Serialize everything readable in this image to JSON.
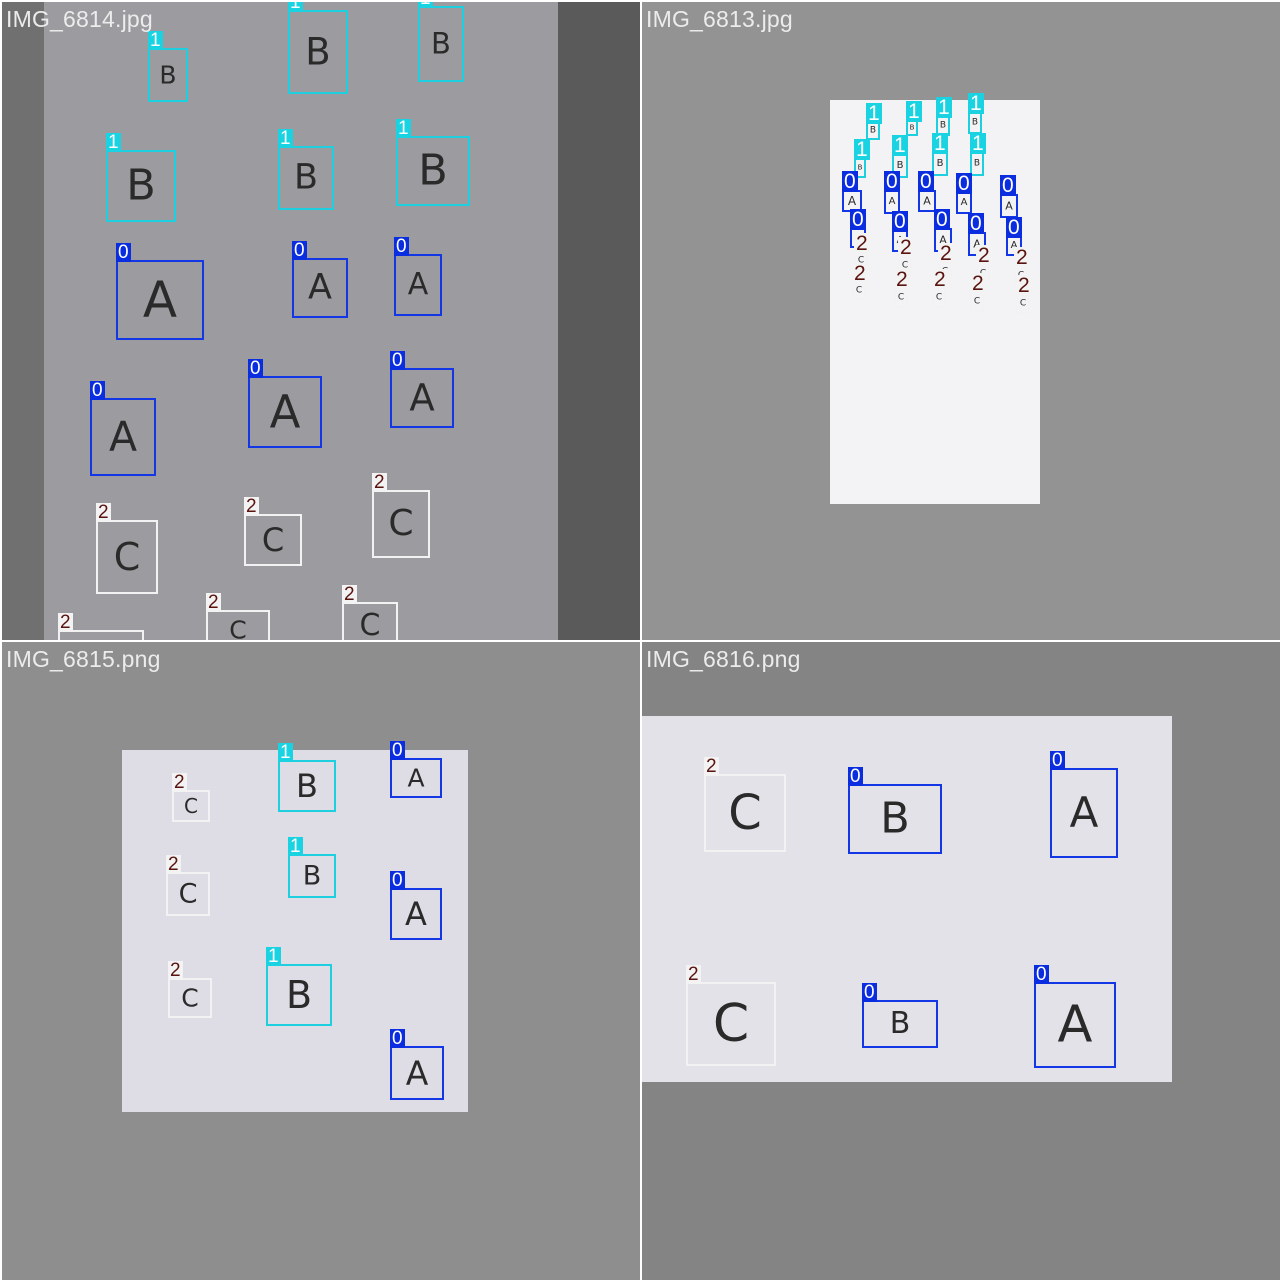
{
  "mosaic": {
    "tiles": [
      {
        "filename": "IMG_6814.jpg",
        "background": "#5a5a5a",
        "paper_color": "#9c9ca0",
        "detections": [
          {
            "cls": "1",
            "letter": "B"
          },
          {
            "cls": "1",
            "letter": "B"
          },
          {
            "cls": "1",
            "letter": "B"
          },
          {
            "cls": "1",
            "letter": "B"
          },
          {
            "cls": "1",
            "letter": "B"
          },
          {
            "cls": "1",
            "letter": "B"
          },
          {
            "cls": "0",
            "letter": "A"
          },
          {
            "cls": "0",
            "letter": "A"
          },
          {
            "cls": "0",
            "letter": "A"
          },
          {
            "cls": "0",
            "letter": "A"
          },
          {
            "cls": "0",
            "letter": "A"
          },
          {
            "cls": "0",
            "letter": "A"
          },
          {
            "cls": "2",
            "letter": "C"
          },
          {
            "cls": "2",
            "letter": "C"
          },
          {
            "cls": "2",
            "letter": "C"
          },
          {
            "cls": "2",
            "letter": ""
          },
          {
            "cls": "2",
            "letter": "C"
          },
          {
            "cls": "2",
            "letter": "C"
          }
        ]
      },
      {
        "filename": "IMG_6813.jpg",
        "background": "#939393",
        "paper_color": "#f3f3f5",
        "detections": [
          {
            "cls": "1",
            "letter": "B"
          },
          {
            "cls": "1",
            "letter": "B"
          },
          {
            "cls": "1",
            "letter": "B"
          },
          {
            "cls": "1",
            "letter": "B"
          },
          {
            "cls": "1",
            "letter": "B"
          },
          {
            "cls": "1",
            "letter": "B"
          },
          {
            "cls": "1",
            "letter": "B"
          },
          {
            "cls": "1",
            "letter": "B"
          },
          {
            "cls": "0",
            "letter": "A"
          },
          {
            "cls": "0",
            "letter": "A"
          },
          {
            "cls": "0",
            "letter": "A"
          },
          {
            "cls": "0",
            "letter": "A"
          },
          {
            "cls": "0",
            "letter": "A"
          },
          {
            "cls": "0",
            "letter": "A"
          },
          {
            "cls": "0",
            "letter": "A"
          },
          {
            "cls": "0",
            "letter": "A"
          },
          {
            "cls": "0",
            "letter": "A"
          },
          {
            "cls": "0",
            "letter": "A"
          },
          {
            "cls": "2",
            "letter": "C"
          },
          {
            "cls": "2",
            "letter": "C"
          },
          {
            "cls": "2",
            "letter": "C"
          },
          {
            "cls": "2",
            "letter": "C"
          },
          {
            "cls": "2",
            "letter": "C"
          },
          {
            "cls": "2",
            "letter": "C"
          },
          {
            "cls": "2",
            "letter": "C"
          },
          {
            "cls": "2",
            "letter": "C"
          },
          {
            "cls": "2",
            "letter": "C"
          },
          {
            "cls": "2",
            "letter": "C"
          }
        ]
      },
      {
        "filename": "IMG_6815.png",
        "background": "#8e8e8e",
        "paper_color": "#dedde6",
        "detections": [
          {
            "cls": "2",
            "letter": "C"
          },
          {
            "cls": "1",
            "letter": "B"
          },
          {
            "cls": "0",
            "letter": "A"
          },
          {
            "cls": "2",
            "letter": "C"
          },
          {
            "cls": "1",
            "letter": "B"
          },
          {
            "cls": "0",
            "letter": "A"
          },
          {
            "cls": "2",
            "letter": "C"
          },
          {
            "cls": "1",
            "letter": "B"
          },
          {
            "cls": "0",
            "letter": "A"
          }
        ]
      },
      {
        "filename": "IMG_6816.png",
        "background": "#848484",
        "paper_color": "#e2e2e8",
        "detections": [
          {
            "cls": "2",
            "letter": "C"
          },
          {
            "cls": "0",
            "letter": "B"
          },
          {
            "cls": "0",
            "letter": "A"
          },
          {
            "cls": "2",
            "letter": "C"
          },
          {
            "cls": "0",
            "letter": "B"
          },
          {
            "cls": "0",
            "letter": "A"
          }
        ]
      }
    ]
  }
}
